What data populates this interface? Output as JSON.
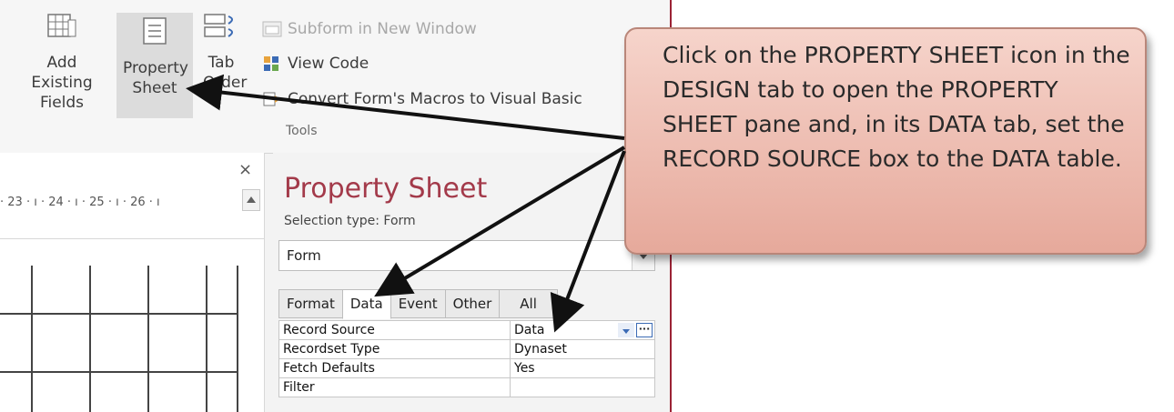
{
  "ribbon": {
    "add_existing_fields": "Add Existing Fields",
    "property_sheet": "Property Sheet",
    "tab_order": "Tab Order",
    "subform_new_window": "Subform in New Window",
    "view_code": "View Code",
    "convert_macros": "Convert Form's Macros to Visual Basic",
    "tools_group": "Tools"
  },
  "design_view": {
    "close_symbol": "×",
    "ruler_text": "· 23 · ı · 24 · ı · 25 · ı · 26 · ı"
  },
  "property_sheet": {
    "title": "Property Sheet",
    "selection_type": "Selection type:  Form",
    "combo_value": "Form",
    "tabs": [
      "Format",
      "Data",
      "Event",
      "Other",
      "All"
    ],
    "active_tab": "Data",
    "rows": [
      {
        "name": "Record Source",
        "value": "Data"
      },
      {
        "name": "Recordset Type",
        "value": "Dynaset"
      },
      {
        "name": "Fetch Defaults",
        "value": "Yes"
      },
      {
        "name": "Filter",
        "value": ""
      }
    ],
    "ellipsis": "···"
  },
  "callout": {
    "text": "Click on the PROPERTY SHEET icon in the DESIGN tab to open the PROPERTY SHEET pane and, in its DATA tab, set the RECORD SOURCE box to the DATA table."
  },
  "colors": {
    "accent": "#a33a4a",
    "callout_fill": "#eebbae",
    "window_border": "#9b2335"
  }
}
